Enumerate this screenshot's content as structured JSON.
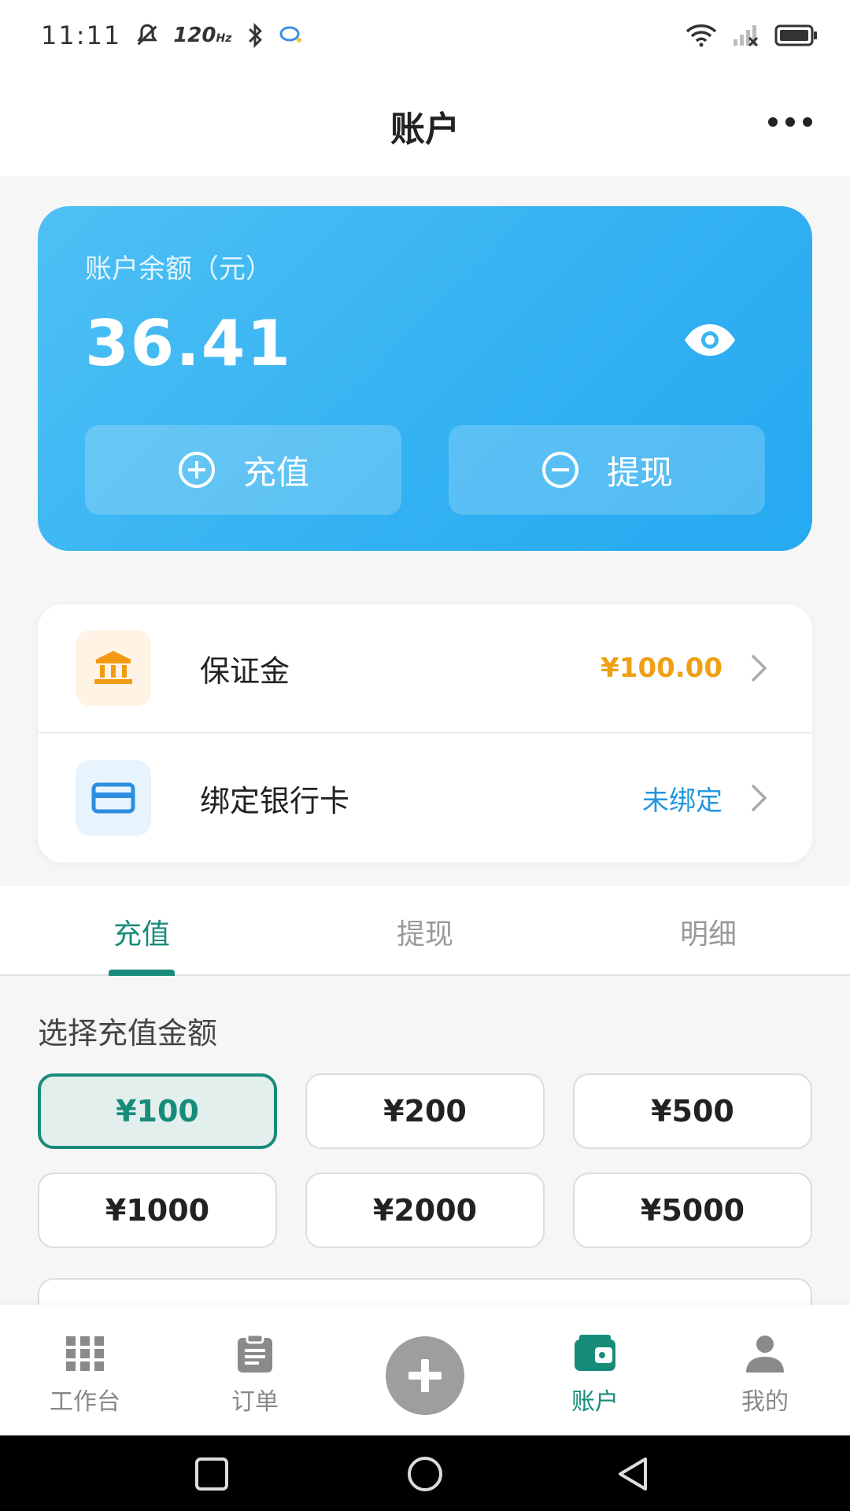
{
  "status_bar": {
    "time": "11:11",
    "refresh_rate": "120",
    "refresh_unit": "Hz"
  },
  "header": {
    "title": "账户"
  },
  "balance_card": {
    "label": "账户余额（元）",
    "amount": "36.41",
    "recharge_label": "充值",
    "withdraw_label": "提现",
    "gradient_start": "#4ec0f4",
    "gradient_end": "#25a9f1"
  },
  "list": [
    {
      "icon": "bank-icon",
      "label": "保证金",
      "value": "¥100.00",
      "value_color": "#f0a014"
    },
    {
      "icon": "card-icon",
      "label": "绑定银行卡",
      "value": "未绑定",
      "value_color": "#2196e0"
    }
  ],
  "tabs": {
    "items": [
      "充值",
      "提现",
      "明细"
    ],
    "active": "充值"
  },
  "amount_section": {
    "title": "选择充值金额",
    "options": [
      "¥100",
      "¥200",
      "¥500",
      "¥1000",
      "¥2000",
      "¥5000"
    ],
    "selected": "¥100"
  },
  "bottom_nav": {
    "items": [
      "工作台",
      "订单",
      "账户",
      "我的"
    ],
    "active": "账户"
  },
  "colors": {
    "accent": "#188c7a",
    "orange": "#f0a014",
    "blue_link": "#2196e0"
  }
}
